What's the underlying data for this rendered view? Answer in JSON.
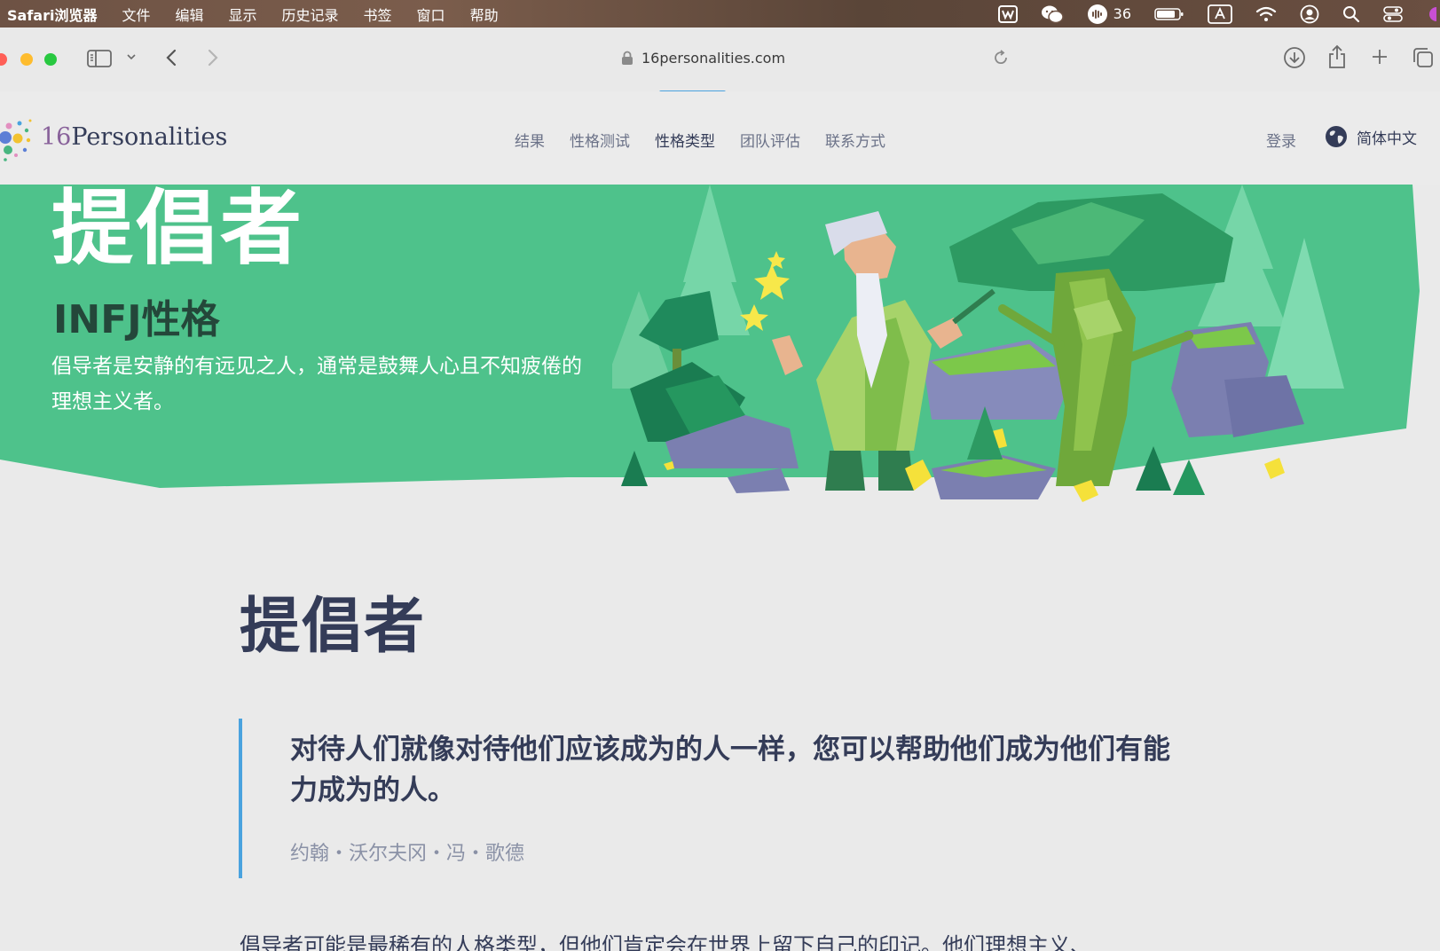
{
  "menubar": {
    "app": "Safari浏览器",
    "items": [
      "文件",
      "编辑",
      "显示",
      "历史记录",
      "书签",
      "窗口",
      "帮助"
    ],
    "battery_percent": "36"
  },
  "browser": {
    "url": "16personalities.com"
  },
  "site": {
    "logo_number": "16",
    "logo_word": "Personalities",
    "nav": [
      "结果",
      "性格测试",
      "性格类型",
      "团队评估",
      "联系方式"
    ],
    "active_nav": "性格类型",
    "login": "登录",
    "language": "简体中文"
  },
  "hero": {
    "title": "提倡者",
    "subtitle": "INFJ性格",
    "description": "倡导者是安静的有远见之人，通常是鼓舞人心且不知疲倦的理想主义者。"
  },
  "content": {
    "title": "提倡者",
    "quote": "对待人们就像对待他们应该成为的人一样，您可以帮助他们成为他们有能力成为的人。",
    "quote_author": "约翰・沃尔夫冈・冯・歌德",
    "body": "倡导者可能是最稀有的人格类型，但他们肯定会在世界上留下自己的印记。他们理想主义、"
  },
  "colors": {
    "hero_green": "#4ec28b",
    "accent_blue": "#4aa3df",
    "text_dark": "#343c58",
    "logo_purple": "#88619a"
  }
}
